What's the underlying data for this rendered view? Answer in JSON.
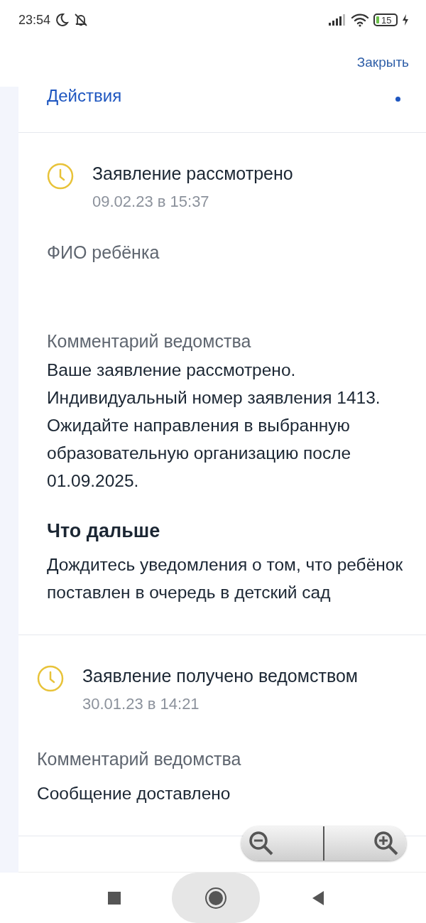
{
  "status_bar": {
    "time": "23:54",
    "battery": "15"
  },
  "header": {
    "close_label": "Закрыть"
  },
  "actions": {
    "label": "Действия"
  },
  "events": [
    {
      "title": "Заявление рассмотрено",
      "date": "09.02.23 в 15:37",
      "child_label": "ФИО ребёнка",
      "comment_label": "Комментарий ведомства",
      "comment": "Ваше заявление рассмотрено. Индивидуальный номер заявления 1413. Ожидайте направления в выбранную образовательную организацию после 01.09.2025.",
      "next_title": "Что дальше",
      "next_text": "Дождитесь уведомления о том, что ребёнок поставлен в очередь в детский сад"
    },
    {
      "title": "Заявление получено ведомством",
      "date": "30.01.23 в 14:21",
      "comment_label": "Комментарий ведомства",
      "comment": "Сообщение доставлено"
    }
  ]
}
